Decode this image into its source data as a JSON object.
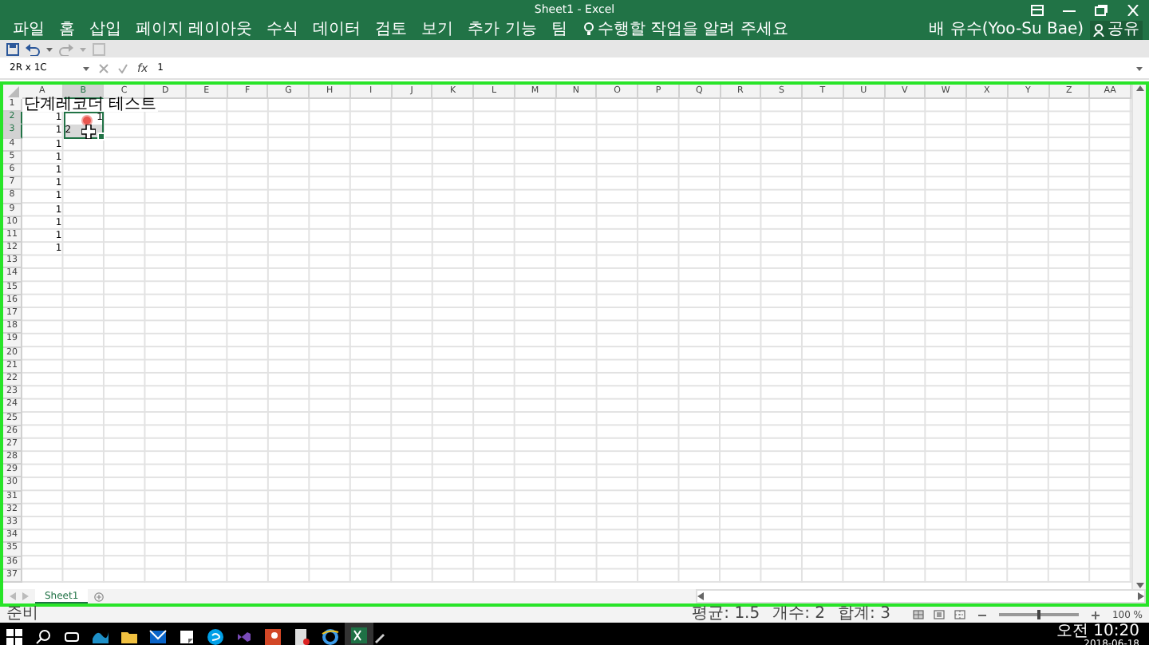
{
  "window": {
    "title": "Sheet1 - Excel"
  },
  "ribbon_tabs": [
    "파일",
    "홈",
    "삽입",
    "페이지 레이아웃",
    "수식",
    "데이터",
    "검토",
    "보기",
    "추가 기능",
    "팀"
  ],
  "tell_me": "수행할 작업을 알려 주세요",
  "user": "배 유수(Yoo-Su Bae)",
  "share": "공유",
  "formula_bar": {
    "name_box": "2R x 1C",
    "function_label": "fx",
    "value": "1"
  },
  "columns": [
    {
      "label": "A",
      "selected": false
    },
    {
      "label": "B",
      "selected": true
    },
    {
      "label": "C",
      "selected": false
    },
    {
      "label": "D",
      "selected": false
    },
    {
      "label": "E",
      "selected": false
    },
    {
      "label": "F",
      "selected": false
    },
    {
      "label": "G",
      "selected": false
    },
    {
      "label": "H",
      "selected": false
    },
    {
      "label": "I",
      "selected": false
    },
    {
      "label": "J",
      "selected": false
    },
    {
      "label": "K",
      "selected": false
    },
    {
      "label": "L",
      "selected": false
    },
    {
      "label": "M",
      "selected": false
    },
    {
      "label": "N",
      "selected": false
    },
    {
      "label": "O",
      "selected": false
    },
    {
      "label": "P",
      "selected": false
    },
    {
      "label": "Q",
      "selected": false
    },
    {
      "label": "R",
      "selected": false
    },
    {
      "label": "S",
      "selected": false
    },
    {
      "label": "T",
      "selected": false
    },
    {
      "label": "U",
      "selected": false
    },
    {
      "label": "V",
      "selected": false
    },
    {
      "label": "W",
      "selected": false
    },
    {
      "label": "X",
      "selected": false
    },
    {
      "label": "Y",
      "selected": false
    },
    {
      "label": "Z",
      "selected": false
    },
    {
      "label": "AA",
      "selected": false
    }
  ],
  "rows": [
    {
      "label": "1",
      "selected": false,
      "col_a": {
        "text": "단계레코더 테스트",
        "kind": "text"
      }
    },
    {
      "label": "2",
      "selected": true,
      "col_a": {
        "text": "1",
        "kind": "number"
      },
      "col_b": {
        "text": "1",
        "kind": "number"
      }
    },
    {
      "label": "3",
      "selected": true,
      "col_a": {
        "text": "1",
        "kind": "number"
      },
      "col_b": {
        "text": "2",
        "kind": "entry"
      }
    },
    {
      "label": "4",
      "selected": false,
      "col_a": {
        "text": "1",
        "kind": "number"
      }
    },
    {
      "label": "5",
      "selected": false,
      "col_a": {
        "text": "1",
        "kind": "number"
      }
    },
    {
      "label": "6",
      "selected": false,
      "col_a": {
        "text": "1",
        "kind": "number"
      }
    },
    {
      "label": "7",
      "selected": false,
      "col_a": {
        "text": "1",
        "kind": "number"
      }
    },
    {
      "label": "8",
      "selected": false,
      "col_a": {
        "text": "1",
        "kind": "number"
      }
    },
    {
      "label": "9",
      "selected": false,
      "col_a": {
        "text": "1",
        "kind": "number"
      }
    },
    {
      "label": "10",
      "selected": false,
      "col_a": {
        "text": "1",
        "kind": "number"
      }
    },
    {
      "label": "11",
      "selected": false,
      "col_a": {
        "text": "1",
        "kind": "number"
      }
    },
    {
      "label": "12",
      "selected": false,
      "col_a": {
        "text": "1",
        "kind": "number"
      }
    },
    {
      "label": "13",
      "selected": false
    },
    {
      "label": "14",
      "selected": false
    },
    {
      "label": "15",
      "selected": false
    },
    {
      "label": "16",
      "selected": false
    },
    {
      "label": "17",
      "selected": false
    },
    {
      "label": "18",
      "selected": false
    },
    {
      "label": "19",
      "selected": false
    },
    {
      "label": "20",
      "selected": false
    },
    {
      "label": "21",
      "selected": false
    },
    {
      "label": "22",
      "selected": false
    },
    {
      "label": "23",
      "selected": false
    },
    {
      "label": "24",
      "selected": false
    },
    {
      "label": "25",
      "selected": false
    },
    {
      "label": "26",
      "selected": false
    },
    {
      "label": "27",
      "selected": false
    },
    {
      "label": "28",
      "selected": false
    },
    {
      "label": "29",
      "selected": false
    },
    {
      "label": "30",
      "selected": false
    },
    {
      "label": "31",
      "selected": false
    },
    {
      "label": "32",
      "selected": false
    },
    {
      "label": "33",
      "selected": false
    },
    {
      "label": "34",
      "selected": false
    },
    {
      "label": "35",
      "selected": false
    },
    {
      "label": "36",
      "selected": false
    },
    {
      "label": "37",
      "selected": false
    }
  ],
  "sheet_tabs": [
    {
      "label": "Sheet1",
      "selected": true
    }
  ],
  "status_bar": {
    "mode": "준비",
    "stats": [
      "평균: 1.5",
      "개수: 2",
      "합계: 3"
    ],
    "zoom": {
      "level": 0.5,
      "reading": "100 %"
    }
  },
  "taskbar": {
    "time": "오전 10:20",
    "date": "2018-06-18"
  }
}
